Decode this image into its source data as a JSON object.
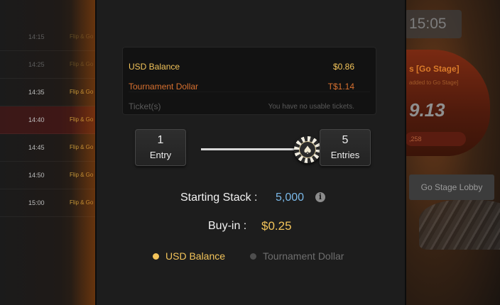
{
  "schedule": [
    {
      "time": "14:15",
      "name": "Flip & Go",
      "dim": true
    },
    {
      "time": "14:25",
      "name": "Flip & Go",
      "dim": true
    },
    {
      "time": "14:35",
      "name": "Flip & Go",
      "dim": false
    },
    {
      "time": "14:40",
      "name": "Flip & Go",
      "dim": false,
      "active": true
    },
    {
      "time": "14:45",
      "name": "Flip & Go",
      "dim": false
    },
    {
      "time": "14:50",
      "name": "Flip & Go",
      "dim": false
    },
    {
      "time": "15:00",
      "name": "Flip & Go",
      "dim": false
    }
  ],
  "promo": {
    "clock": "15:05",
    "title": "s [Go Stage]",
    "subtitle": "added to Go Stage]",
    "amount": "9.13",
    "pill": ",258",
    "lobby_button": "Go Stage Lobby"
  },
  "balances": {
    "usd_label": "USD Balance",
    "usd_value": "$0.86",
    "td_label": "Tournament Dollar",
    "td_value": "T$1.14",
    "ticket_label": "Ticket(s)",
    "ticket_value": "You have no usable tickets."
  },
  "entries": {
    "min_num": "1",
    "min_word": "Entry",
    "max_num": "5",
    "max_word": "Entries",
    "slider_fraction": 1.0
  },
  "starting_stack": {
    "label": "Starting Stack :",
    "value": "5,000"
  },
  "buyin": {
    "label": "Buy-in :",
    "value": "$0.25"
  },
  "payment": {
    "options": [
      "USD Balance",
      "Tournament Dollar"
    ],
    "selected": "USD Balance"
  },
  "colors": {
    "gold": "#f3c45a",
    "orange": "#d8702f",
    "blue": "#7ab8e8"
  },
  "icons": {
    "info": "info-icon",
    "chip": "poker-chip-spade-icon"
  }
}
